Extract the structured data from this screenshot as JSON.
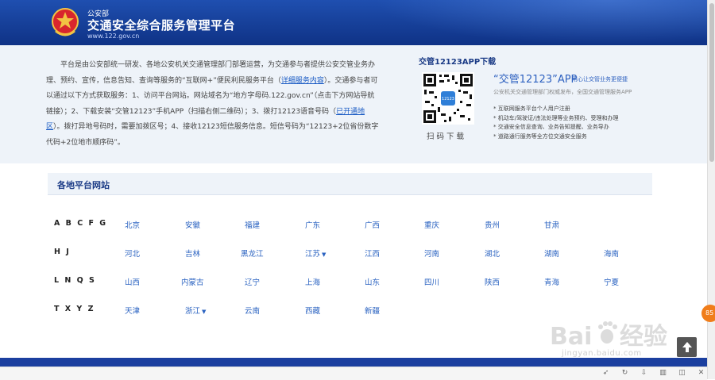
{
  "header": {
    "dept": "公安部",
    "title": "交通安全综合服务管理平台",
    "url": "www.122.gov.cn"
  },
  "intro": {
    "part1": "平台是由公安部统一研发、各地公安机关交通管理部门部署运营，为交通参与者提供公安交管业务办理、预约、宣传，信息告知、查询等服务的“互联网+”便民利民服务平台（",
    "detail_link": "详细服务内容",
    "part2": "）。交通参与者可以通过以下方式获取服务：1、访问平台网站。网站域名为“地方字母码.122.gov.cn”（点击下方网站导航链接）；2、下载安装“交管12123”手机APP（扫描右侧二维码）；3、拨打12123语音号码（",
    "region_link": "已开通地区",
    "part3": "）。拨打异地号码时，需要加拨区号；4、接收12123短信服务信息。短信号码为“12123+2位省份数字代码+2位地市顺序码”。"
  },
  "app": {
    "section_title": "交管12123APP下载",
    "scan_label": "扫码下载",
    "name": "“交管12123”APP",
    "slogan": "用心让交管业务更便捷",
    "desc": "公安机关交通管理部门权威发布，全国交通管理服务APP",
    "features": [
      "互联网服务平台个人用户注册",
      "机动车/驾驶证/违法处理等业务预约、受理和办理",
      "交通安全信息查询、业务告知提醒、业务导办",
      "道路通行服务等全方位交通安全服务"
    ]
  },
  "regions": {
    "title": "各地平台网站",
    "rows": [
      {
        "letters": "A B C F G",
        "provinces": [
          "北京",
          "安徽",
          "福建",
          "广东",
          "广西",
          "重庆",
          "贵州",
          "甘肃"
        ]
      },
      {
        "letters": "H J",
        "provinces": [
          "河北",
          "吉林",
          "黑龙江",
          "江苏",
          "江西",
          "河南",
          "湖北",
          "湖南",
          "海南"
        ]
      },
      {
        "letters": "L N Q S",
        "provinces": [
          "山西",
          "内蒙古",
          "辽宁",
          "上海",
          "山东",
          "四川",
          "陕西",
          "青海",
          "宁夏"
        ]
      },
      {
        "letters": "T X Y Z",
        "provinces": [
          "天津",
          "浙江",
          "云南",
          "西藏",
          "新疆"
        ]
      }
    ]
  },
  "float_badge": "85",
  "watermark": {
    "url": "jingyan.baidu.com"
  },
  "colors": {
    "header": "#163f98",
    "link": "#2b63c1",
    "panel": "#eef3f9"
  }
}
